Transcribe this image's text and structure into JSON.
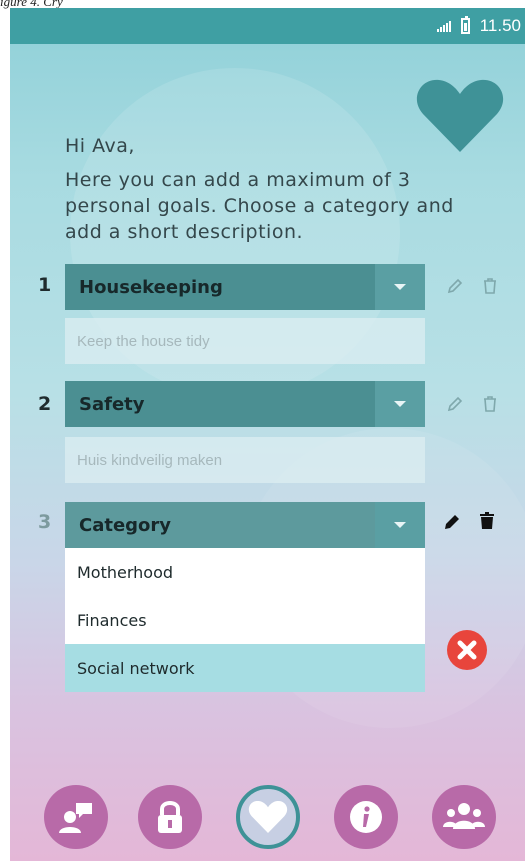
{
  "caption": "igure 4. Cry",
  "status": {
    "time": "11.50",
    "signal_icon": "signal-icon",
    "battery_icon": "battery-icon"
  },
  "intro": {
    "greeting": "Hi Ava,",
    "text": "Here you can add a maximum of 3 personal goals. Choose a category and add a short description."
  },
  "goals": [
    {
      "number": "1",
      "category": "Housekeeping",
      "description": "Keep the house tidy"
    },
    {
      "number": "2",
      "category": "Safety",
      "description": "Huis kindveilig maken"
    },
    {
      "number": "3",
      "category": "Category",
      "description": ""
    }
  ],
  "dropdown": {
    "options": [
      "Motherhood",
      "Finances",
      "Social network"
    ],
    "highlighted": "Social network"
  },
  "nav": {
    "items": [
      {
        "icon": "chat-user-icon"
      },
      {
        "icon": "lock-icon"
      },
      {
        "icon": "heart-icon",
        "active": true
      },
      {
        "icon": "info-icon"
      },
      {
        "icon": "group-icon"
      }
    ]
  },
  "colors": {
    "accent": "#3f9fa3",
    "select_bg": "#4b8f92",
    "nav_bg": "#b86aa8",
    "close": "#e8453c"
  }
}
